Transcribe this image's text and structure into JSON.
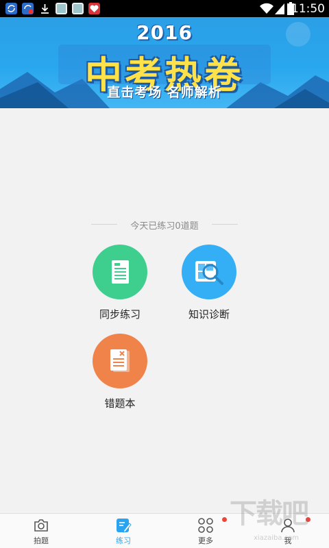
{
  "status_bar": {
    "time": "11:50",
    "notification_icons": [
      "sync-icon",
      "sync-alert-icon",
      "download-icon",
      "app-icon",
      "app-icon",
      "heart-app-icon"
    ],
    "signal_icons": [
      "wifi-icon",
      "cell-signal-icon",
      "battery-icon"
    ]
  },
  "banner": {
    "year": "2016",
    "title": "中考热卷",
    "subtitle": "直击考场  名师解析"
  },
  "practice": {
    "today_count_text": "今天已练习0道题"
  },
  "menu": [
    {
      "label": "同步练习",
      "icon": "document-icon",
      "color": "#3ecf8e"
    },
    {
      "label": "知识诊断",
      "icon": "magnifier-icon",
      "color": "#34aef5"
    },
    {
      "label": "错题本",
      "icon": "wrong-book-icon",
      "color": "#f0834a"
    }
  ],
  "bottom_nav": [
    {
      "label": "拍题",
      "icon": "camera-icon",
      "active": false
    },
    {
      "label": "练习",
      "icon": "edit-icon",
      "active": true
    },
    {
      "label": "更多",
      "icon": "grid-icon",
      "active": false
    },
    {
      "label": "我",
      "icon": "person-icon",
      "active": false
    }
  ],
  "colors": {
    "accent": "#2aa4f0",
    "banner_blue": "#2b9fe6",
    "banner_yellow": "#ffe24a",
    "badge_red": "#f0443a"
  },
  "watermark": {
    "main": "下载吧",
    "sub": "xiazaiba.com"
  }
}
